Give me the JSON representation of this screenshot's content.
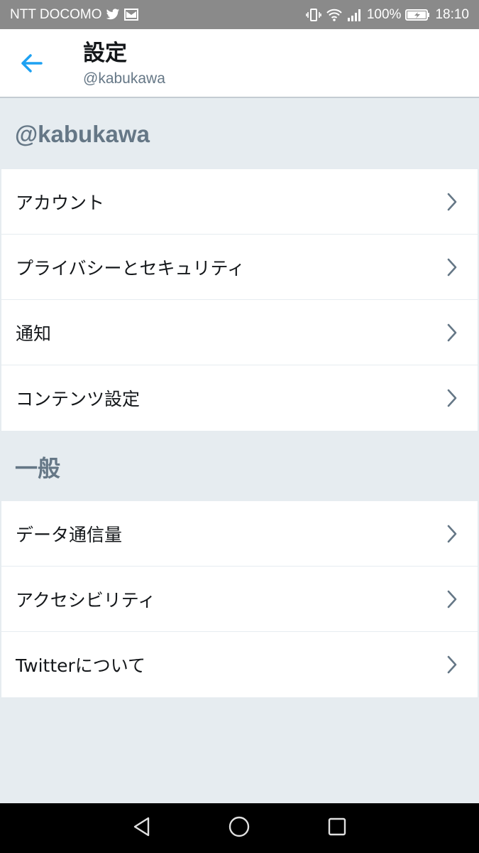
{
  "status_bar": {
    "carrier": "NTT DOCOMO",
    "battery_percent": "100%",
    "time": "18:10",
    "icons_left": [
      "twitter-icon",
      "mail-icon"
    ],
    "icons_right": [
      "vibrate-icon",
      "wifi-icon",
      "signal-icon",
      "battery-charging-icon"
    ]
  },
  "header": {
    "title": "設定",
    "subtitle": "@kabukawa",
    "back_icon": "arrow-left-icon",
    "accent_color": "#1da1f2"
  },
  "sections": [
    {
      "title": "@kabukawa",
      "items": [
        {
          "label": "アカウント"
        },
        {
          "label": "プライバシーとセキュリティ"
        },
        {
          "label": "通知"
        },
        {
          "label": "コンテンツ設定"
        }
      ]
    },
    {
      "title": "一般",
      "items": [
        {
          "label": "データ通信量"
        },
        {
          "label": "アクセシビリティ"
        },
        {
          "label": "Twitterについて"
        }
      ]
    }
  ],
  "nav_bar": {
    "buttons": [
      "back-triangle-icon",
      "home-circle-icon",
      "recents-square-icon"
    ]
  }
}
